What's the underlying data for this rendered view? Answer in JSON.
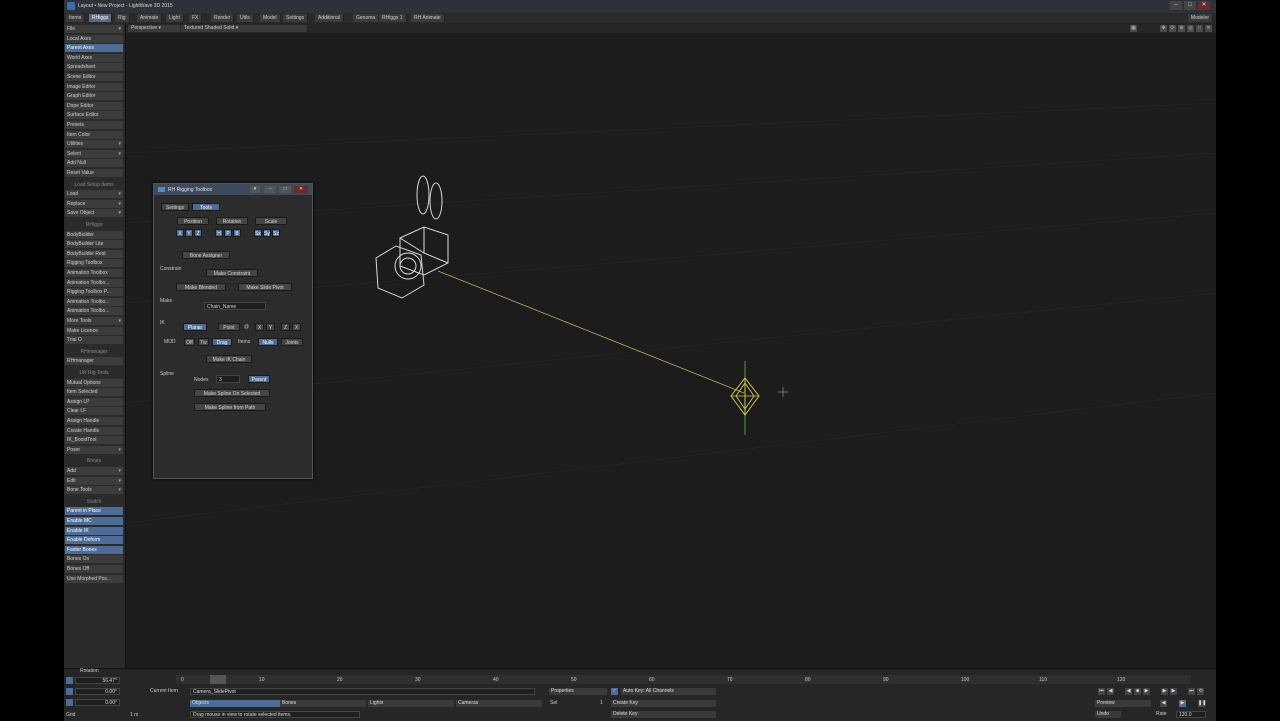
{
  "window": {
    "title": "Layout • New Project - LightWave 3D 2015"
  },
  "menu_tabs": [
    "Items",
    "RHiggs",
    "Rig",
    "Animate",
    "Light",
    "FX",
    "Render",
    "Utils",
    "Model",
    "Settings",
    "Additional",
    "Genoma",
    "RHiggs 1",
    "RH Animate"
  ],
  "menu_right": "Modeler",
  "sidebar": {
    "items": [
      {
        "label": "File",
        "dd": true
      },
      {
        "label": "Local Axes"
      },
      {
        "label": "Parent Axes",
        "on": true
      },
      {
        "label": "World Axes"
      },
      {
        "label": "Spreadsheet"
      },
      {
        "label": "Scene Editor"
      },
      {
        "label": "Image Editor"
      },
      {
        "label": "Graph Editor"
      },
      {
        "label": "Dope Editor"
      },
      {
        "label": "Surface Editor"
      },
      {
        "label": "Presets"
      },
      {
        "label": "Item Color"
      },
      {
        "label": "Utilities",
        "dd": true
      },
      {
        "label": "Select",
        "dd": true
      },
      {
        "label": "Add Null"
      },
      {
        "label": "Reset Value"
      },
      {
        "label": "Load Setup Items",
        "head": true
      },
      {
        "label": "Load",
        "dd": true
      },
      {
        "label": "Replace",
        "dd": true
      },
      {
        "label": "Save Object",
        "dd": true
      },
      {
        "label": "RHiggs",
        "head": true
      },
      {
        "label": "BodyBuilder"
      },
      {
        "label": "BodyBuilder Lite"
      },
      {
        "label": "BodyBuilder Rest"
      },
      {
        "label": "Rigging Toolbox"
      },
      {
        "label": "Animation Toolbox"
      },
      {
        "label": "Animation Toolbo..."
      },
      {
        "label": "Rigging Toolbox P..."
      },
      {
        "label": "Animation Toolbo..."
      },
      {
        "label": "Animation Toolbo..."
      },
      {
        "label": "More Tools",
        "dd": true
      },
      {
        "label": "Make Licence"
      },
      {
        "label": "Trial O"
      },
      {
        "label": "RHmanager",
        "head": true
      },
      {
        "label": "RHmanager"
      },
      {
        "label": "LW Rig Tools",
        "head": true
      },
      {
        "label": "Mutual Options"
      },
      {
        "label": "Item Selected"
      },
      {
        "label": "Assign LP"
      },
      {
        "label": "Clear LF"
      },
      {
        "label": "Assign Handle"
      },
      {
        "label": "Create Handle"
      },
      {
        "label": "IK_BoostTool"
      },
      {
        "label": "Poser",
        "dd": true
      },
      {
        "label": "Bones",
        "head": true
      },
      {
        "label": "Add",
        "dd": true
      },
      {
        "label": "Edit",
        "dd": true
      },
      {
        "label": "Bone Tools",
        "dd": true
      },
      {
        "label": "Switch",
        "head": true
      },
      {
        "label": "Parent in Place",
        "on": true
      },
      {
        "label": "Enable MC",
        "on": true
      },
      {
        "label": "Enable IK",
        "on": true
      },
      {
        "label": "Enable Deform",
        "on": true
      },
      {
        "label": "Faster Bones",
        "on": true
      },
      {
        "label": "Bones On"
      },
      {
        "label": "Bones Off"
      },
      {
        "label": "Use Morphed Pos..."
      }
    ]
  },
  "viewport": {
    "view_mode": "Perspective",
    "shading": "Textured Shaded Solid"
  },
  "panel": {
    "title": "RH Rigging Toolbox",
    "tabs": [
      "Settings",
      "Tools"
    ],
    "transform_buttons": [
      "Position",
      "Rotation",
      "Scale"
    ],
    "axis_buttons": [
      "X",
      "Y",
      "Z",
      "H",
      "P",
      "B",
      "Sx",
      "Sy",
      "Sz"
    ],
    "bone_assigner": "Bone Assigner",
    "constrain_label": "Constrain",
    "make_constraint": "Make Constraint",
    "make_blended": "Make Blended",
    "make_slide_pivot": "Make Slide Pivot",
    "make_label": "Make",
    "chain_name": "Chain_Name",
    "ik_label": "IK",
    "ik_planar": "Planar",
    "ik_point": "Point",
    "ik_at": "@",
    "ik_axes": [
      "X",
      "Y",
      "Z",
      "X"
    ],
    "mod_label": "MOD",
    "mod_options": [
      "Off",
      "Tw",
      "Drag"
    ],
    "items_label": "Items",
    "items_options": [
      "Nulls",
      "Joints"
    ],
    "make_ik_chain": "Make IK Chain",
    "spline_label": "Spline",
    "nodes_label": "Nodes",
    "nodes_value": "3",
    "parent_label": "Parent",
    "make_spline_selected": "Make Spline On Selected",
    "make_spline_path": "Make Spline from Path"
  },
  "timeline": {
    "label": "Rotation",
    "values": [
      "56.47°",
      "0.00°",
      "0.00°"
    ],
    "ticks": [
      "0",
      "10",
      "20",
      "30",
      "40",
      "50",
      "60",
      "70",
      "80",
      "90",
      "100",
      "110",
      "120"
    ],
    "grid_label": "Grid",
    "grid_value": "1 m",
    "current_item_label": "Current Item",
    "current_item": "Camera_SlidePivot",
    "properties": "Properties",
    "set_label": "Set",
    "set_value": "1",
    "auto_key": "Auto Key: All Channels",
    "create_key": "Create Key",
    "delete_key": "Delete Key",
    "objects": "Objects",
    "bones": "Bones",
    "lights": "Lights",
    "cameras": "Cameras",
    "status": "Drag mouse in view to rotate selected items.",
    "preview": "Preview",
    "undo": "Undo",
    "rate_label": "Rate",
    "rate_value": "120.0"
  }
}
